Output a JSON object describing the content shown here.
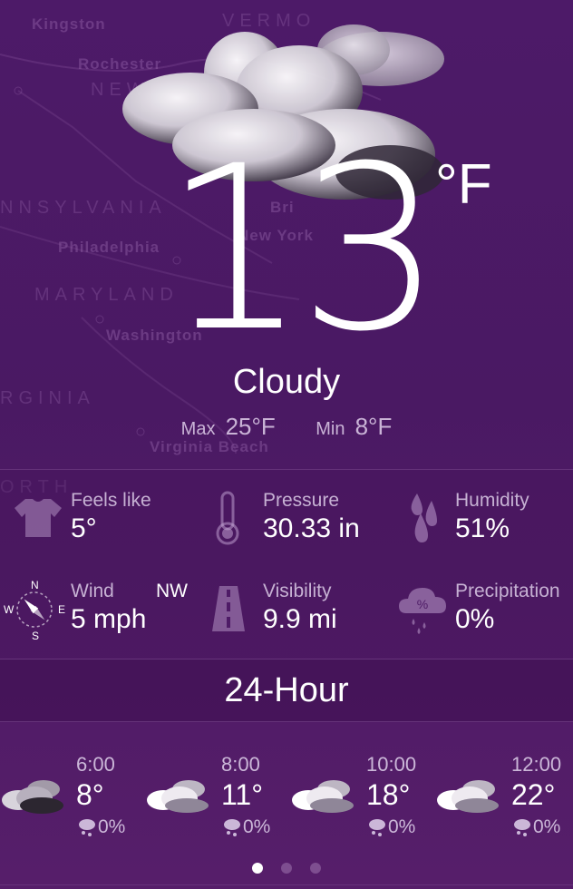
{
  "map": {
    "labels": [
      "Kingston",
      "Rochester",
      "NEW",
      "NNSYLVANIA",
      "Philadelphia",
      "MARYLAND",
      "Washington",
      "RGINIA",
      "Virginia Beach",
      "New York",
      "Bri",
      "VERMO",
      "ORTH"
    ]
  },
  "current": {
    "temperature": "13",
    "unit": "°F",
    "condition": "Cloudy",
    "max_label": "Max",
    "max_value": "25°F",
    "min_label": "Min",
    "min_value": "8°F"
  },
  "details": {
    "feels_like": {
      "label": "Feels like",
      "value": "5°",
      "icon": "tshirt-icon"
    },
    "pressure": {
      "label": "Pressure",
      "value": "30.33 in",
      "icon": "thermometer-icon"
    },
    "humidity": {
      "label": "Humidity",
      "value": "51%",
      "icon": "droplets-icon"
    },
    "wind": {
      "label": "Wind",
      "direction": "NW",
      "value": "5 mph",
      "icon": "compass-icon",
      "compass": {
        "n": "N",
        "s": "S",
        "e": "E",
        "w": "W"
      }
    },
    "visibility": {
      "label": "Visibility",
      "value": "9.9 mi",
      "icon": "road-icon"
    },
    "precipitation": {
      "label": "Precipitation",
      "value": "0%",
      "icon": "rain-cloud-percent-icon"
    }
  },
  "hourly": {
    "title": "24-Hour",
    "items": [
      {
        "time": "6:00",
        "temp": "8°",
        "precip": "0%",
        "icon": "dark-cloud-icon"
      },
      {
        "time": "8:00",
        "temp": "11°",
        "precip": "0%",
        "icon": "cloud-icon"
      },
      {
        "time": "10:00",
        "temp": "18°",
        "precip": "0%",
        "icon": "cloud-icon"
      },
      {
        "time": "12:00",
        "temp": "22°",
        "precip": "0%",
        "icon": "cloud-icon"
      }
    ]
  },
  "pager": {
    "pages": 3,
    "active": 1
  }
}
